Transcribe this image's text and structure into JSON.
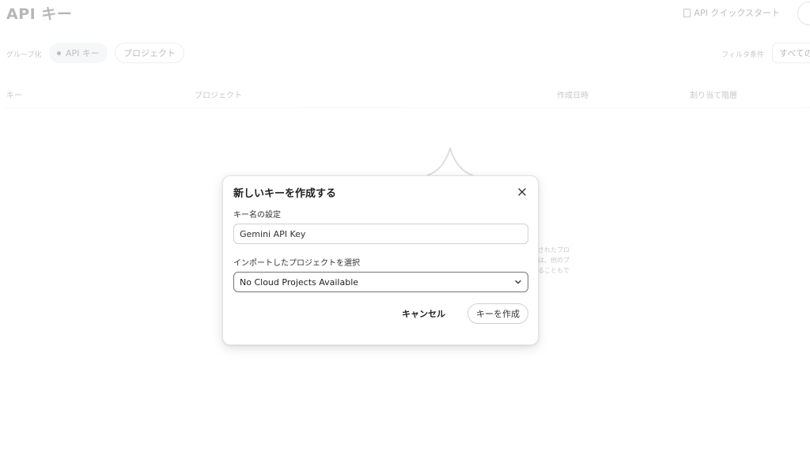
{
  "page": {
    "title": "API キー",
    "quickstart_label": "API クイックスタート",
    "group_label": "グループ化",
    "chips": {
      "api_keys": "API キー",
      "projects": "プロジェクト"
    },
    "filter_label": "フィルタ条件",
    "filter_value": "すべての",
    "table_headers": {
      "key": "キー",
      "project": "プロジェクト",
      "created": "作成日時",
      "tier": "割り当て階層"
    },
    "empty_text_lines": [
      "されたプロ",
      "は、他のプ",
      "ることもで"
    ]
  },
  "dialog": {
    "title": "新しいキーを作成する",
    "key_name_label": "キー名の設定",
    "key_name_value": "Gemini API Key",
    "project_label": "インポートしたプロジェクトを選択",
    "project_value": "No Cloud Projects Available",
    "cancel_label": "キャンセル",
    "create_label": "キーを作成"
  },
  "icons": {
    "close": "close-icon",
    "chevron": "chevron-down-icon",
    "document": "document-icon"
  }
}
